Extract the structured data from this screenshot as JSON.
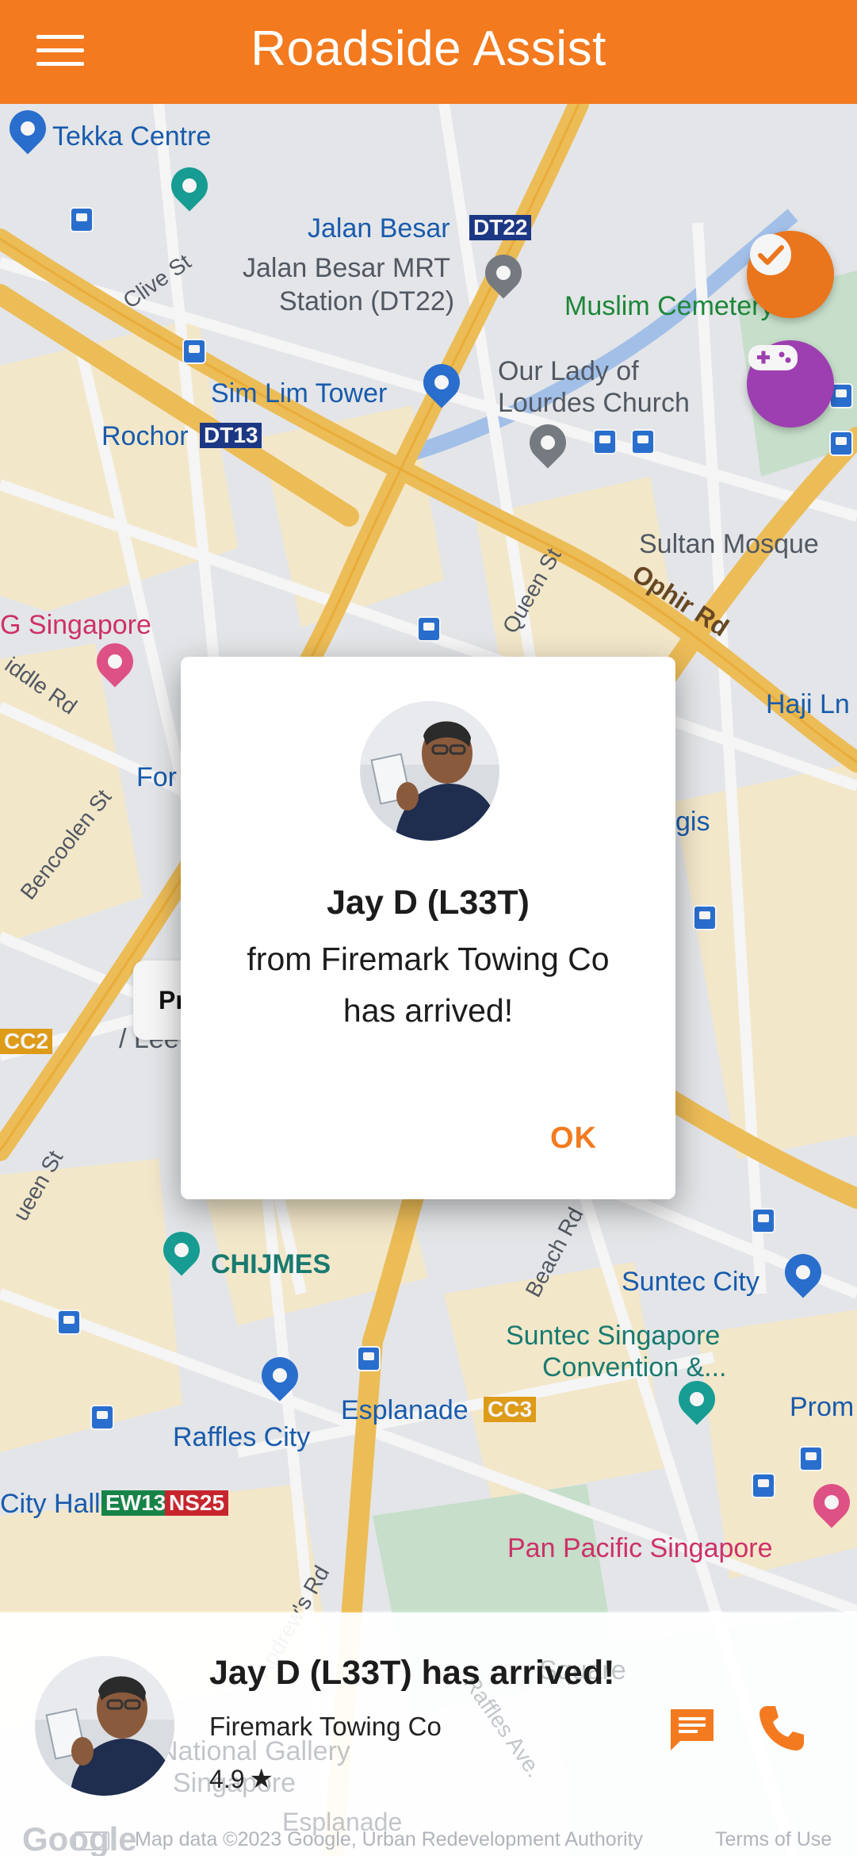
{
  "app": {
    "title": "Roadside Assist"
  },
  "map": {
    "labels": {
      "tekka": "Tekka Centre",
      "jalan_besar": "Jalan Besar",
      "dt22": "DT22",
      "jalan_besar_mrt_1": "Jalan Besar MRT",
      "jalan_besar_mrt_2": "Station (DT22)",
      "clive": "Clive St",
      "muslim_cemetery": "Muslim Cemetery",
      "our_lady_1": "Our Lady of",
      "our_lady_2": "Lourdes Church",
      "sim_lim": "Sim Lim Tower",
      "rochor": "Rochor",
      "dt13": "DT13",
      "sultan_mosque": "Sultan Mosque",
      "ophir": "Ophir Rd",
      "queen_st": "Queen St",
      "g_singapore": "G Singapore",
      "middle_rd": "iddle Rd",
      "haji_ln": "Haji Ln",
      "bencoolen": "Bencoolen St",
      "for": "For",
      "gis": "gis",
      "cc2": "CC2",
      "lee": "/ Lee",
      "queen_st_2": "ueen St",
      "chijmes": "CHIJMES",
      "beach_rd": "Beach Rd",
      "suntec_city": "Suntec City",
      "suntec_conv_1": "Suntec Singapore",
      "suntec_conv_2": "Convention &...",
      "esplanade": "Esplanade",
      "cc3": "CC3",
      "raffles_city": "Raffles City",
      "prom": "Prom",
      "city_hall": "City Hall",
      "ew13": "EW13",
      "ns25": "NS25",
      "pan_pacific": "Pan Pacific Singapore",
      "andrews": "Andrew's Rd",
      "square": "Square",
      "national_gallery_1": "National Gallery",
      "national_gallery_2": "Singapore",
      "raffles_ave": "Raffles Ave.",
      "esplanade_2": "Esplanade"
    },
    "behind_card_text": "Pr",
    "attribution": "Map data ©2023 Google, Urban Redevelopment Authority",
    "terms": "Terms of Use",
    "google_logo": "Google"
  },
  "fabs": {
    "check_icon": "check-circle-icon",
    "game_icon": "gamepad-icon"
  },
  "dialog": {
    "name": "Jay D (L33T)",
    "line1": "from Firemark Towing Co",
    "line2": "has arrived!",
    "ok_label": "OK"
  },
  "driver_card": {
    "headline": "Jay D (L33T) has arrived!",
    "company": "Firemark Towing Co",
    "rating": "4.9",
    "rating_icon": "star-icon",
    "chat_icon": "chat-icon",
    "call_icon": "phone-icon"
  },
  "colors": {
    "accent": "#f37a1f",
    "game_fab": "#a442b8",
    "road_major": "#f6c45b",
    "map_bg": "#edeff2",
    "block": "#fdf1d3"
  }
}
